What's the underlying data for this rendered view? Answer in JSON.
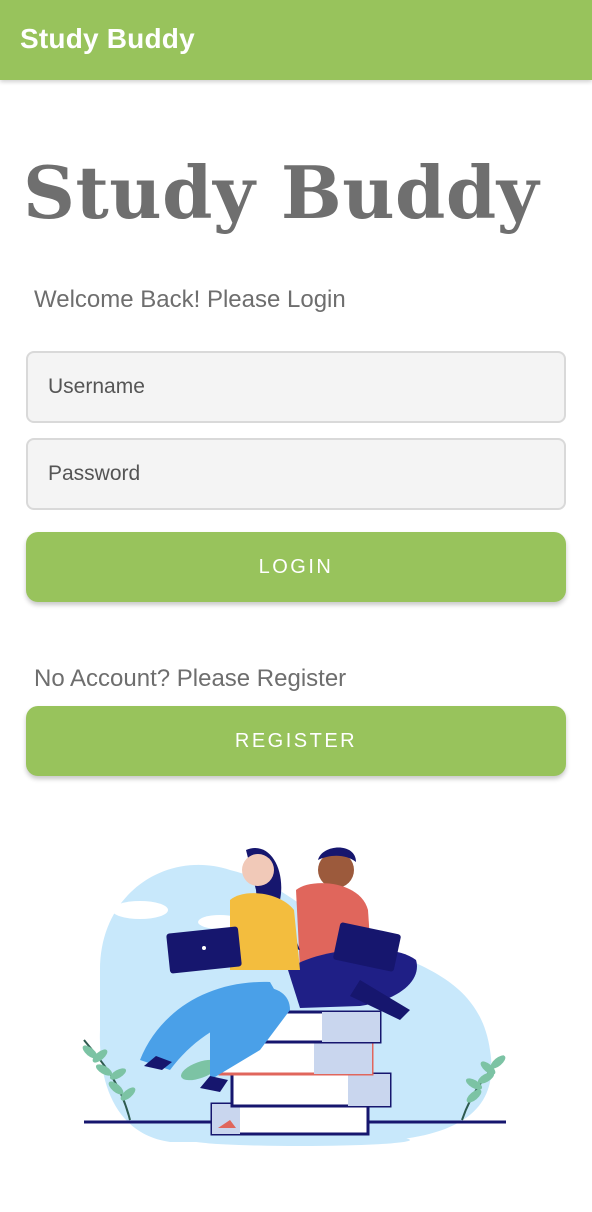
{
  "app_bar": {
    "title": "Study Buddy"
  },
  "hero": {
    "title": "Study Buddy"
  },
  "login": {
    "welcome_text": "Welcome Back! Please Login",
    "username_placeholder": "Username",
    "password_placeholder": "Password",
    "login_label": "LOGIN"
  },
  "register": {
    "prompt_text": "No Account? Please Register",
    "register_label": "REGISTER"
  },
  "illustration": {
    "icon": "students-studying-on-books-illustration"
  },
  "colors": {
    "accent": "#98c35c",
    "title_gray": "#6f6f6f",
    "field_bg": "#f4f4f4"
  }
}
